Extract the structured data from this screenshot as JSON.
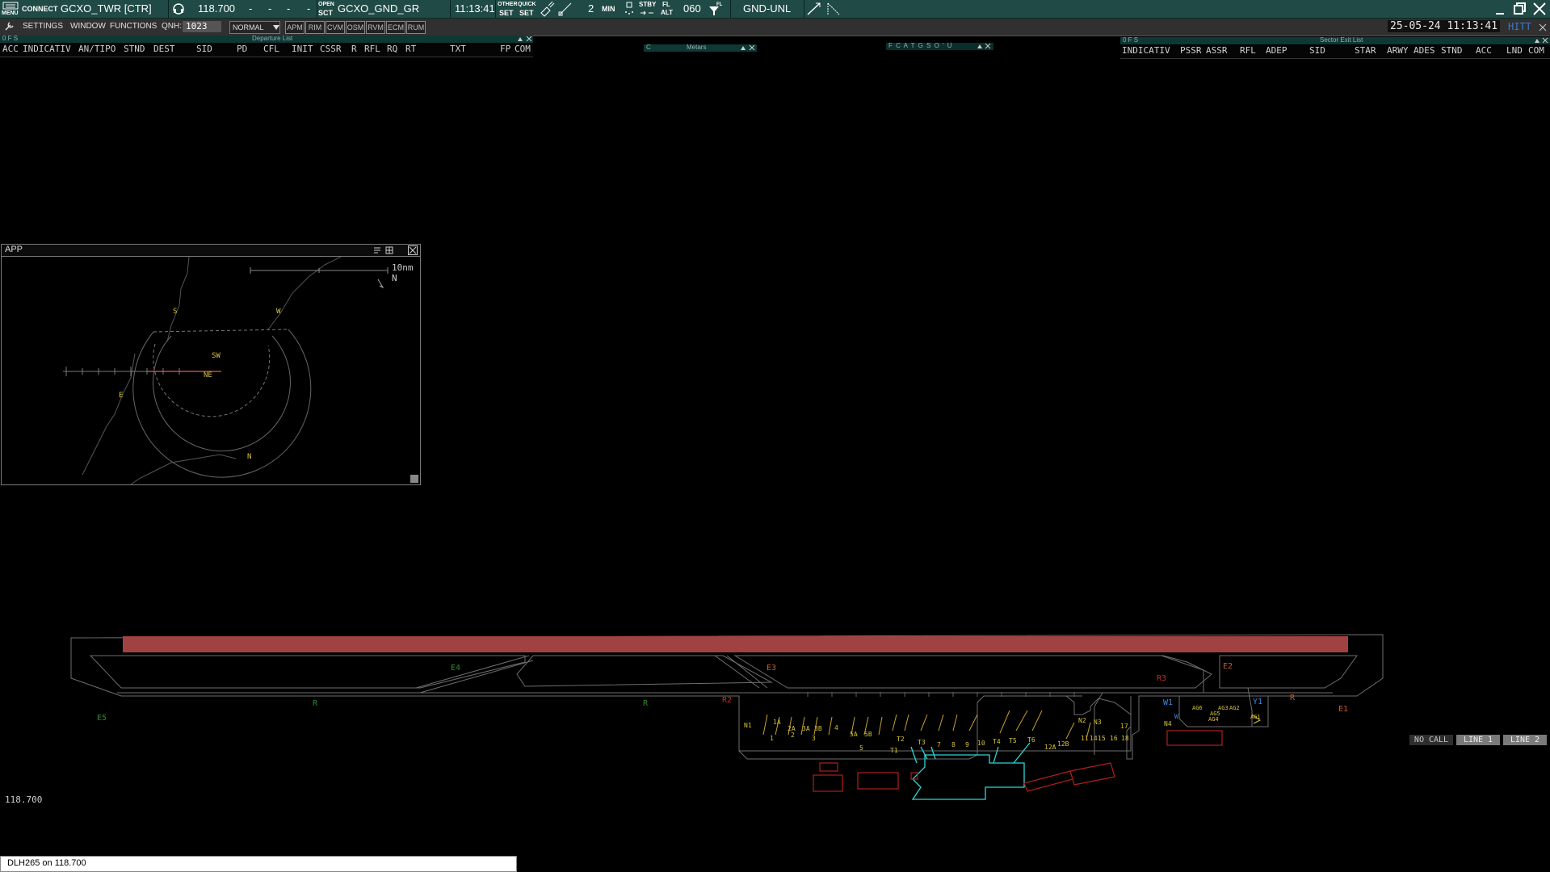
{
  "topbar": {
    "menu_label": "MENU",
    "connect_label": "CONNECT",
    "callsign": "GCXO_TWR [CTR]",
    "frequency": "118.700",
    "dash1": "-",
    "dash2": "-",
    "dash3": "-",
    "dash4": "-",
    "open_label": "OPEN",
    "sct_label": "SCT",
    "sector": "GCXO_GND_GR",
    "time": "11:13:41",
    "other_label": "OTHER",
    "quick_label": "QUICK",
    "set_label": "SET",
    "set2_label": "SET",
    "count": "2",
    "min_label": "MIN",
    "stby_label": "STBY",
    "fl_label": "FL",
    "alt_label": "ALT",
    "fl_value": "060",
    "fl_icon_label": "FL",
    "gnd_label": "GND-UNL"
  },
  "bar2": {
    "settings": "SETTINGS",
    "window": "WINDOW",
    "functions": "FUNCTIONS",
    "qnh_label": "QNH:",
    "qnh_value": "1023",
    "mode": "NORMAL",
    "buttons": [
      "APM",
      "RIM",
      "CVM",
      "OSM",
      "RVM",
      "ECM",
      "RUM"
    ],
    "date_time": "25-05-24 11:13:41",
    "hitt": "HITT"
  },
  "departure_list": {
    "title": "Departure List",
    "ofs": "0 F S",
    "columns": [
      "ACC",
      "INDICATIV",
      "AN/TIPO",
      "STND",
      "DEST",
      "SID",
      "PD",
      "CFL",
      "INIT",
      "CSSR",
      "R",
      "RFL",
      "RQ",
      "RT",
      "TXT",
      "FP",
      "COM"
    ]
  },
  "metars": {
    "c": "C",
    "title": "Metars"
  },
  "fcatgso": {
    "label": "F C A T G S O ' U"
  },
  "sector_exit_list": {
    "title": "Sector Exit List",
    "ofs": "0 F S",
    "columns": [
      "INDICATIV",
      "PSSR",
      "ASSR",
      "RFL",
      "ADEP",
      "SID",
      "STAR",
      "ARWY",
      "ADES",
      "STND",
      "ACC",
      "LND",
      "COM"
    ]
  },
  "app_window": {
    "title": "APP",
    "scale": "10nm",
    "north": "N",
    "fixes": [
      "S",
      "W",
      "SW",
      "NE",
      "E",
      "N"
    ]
  },
  "ground_map": {
    "exits_green": [
      "E4",
      "R",
      "R",
      "E5"
    ],
    "exits_orange": [
      "E3",
      "R2",
      "R3",
      "E2",
      "R",
      "E1"
    ],
    "blue_labels": [
      "W1",
      "Y1",
      "W"
    ],
    "stands_yellow": [
      "N1",
      "1",
      "1A",
      "2",
      "2A",
      "3A",
      "3",
      "3B",
      "4",
      "5A",
      "5B",
      "5",
      "T1",
      "T2",
      "T3",
      "7",
      "8",
      "9",
      "10",
      "T4",
      "T5",
      "T6",
      "N2",
      "N3",
      "17",
      "11",
      "14",
      "15",
      "16",
      "18",
      "12A",
      "12B",
      "N4",
      "AG1",
      "AG2",
      "AG3",
      "AG4",
      "AG5",
      "AG6"
    ]
  },
  "right_panel": {
    "no_call": "NO CALL",
    "line1": "LINE 1",
    "line2": "LINE 2"
  },
  "active_frequency": "118.700",
  "command_line": {
    "text": "DLH265 on 118.700"
  },
  "colors": {
    "topbar": "#1f4a45",
    "runway": "#a04242",
    "taxi_green": "#2f8a2f",
    "exit_orange": "#c85a1e",
    "stand_yellow": "#d6c23a",
    "terminal_cyan": "#2fd6d6",
    "building_red": "#b01e1e"
  }
}
